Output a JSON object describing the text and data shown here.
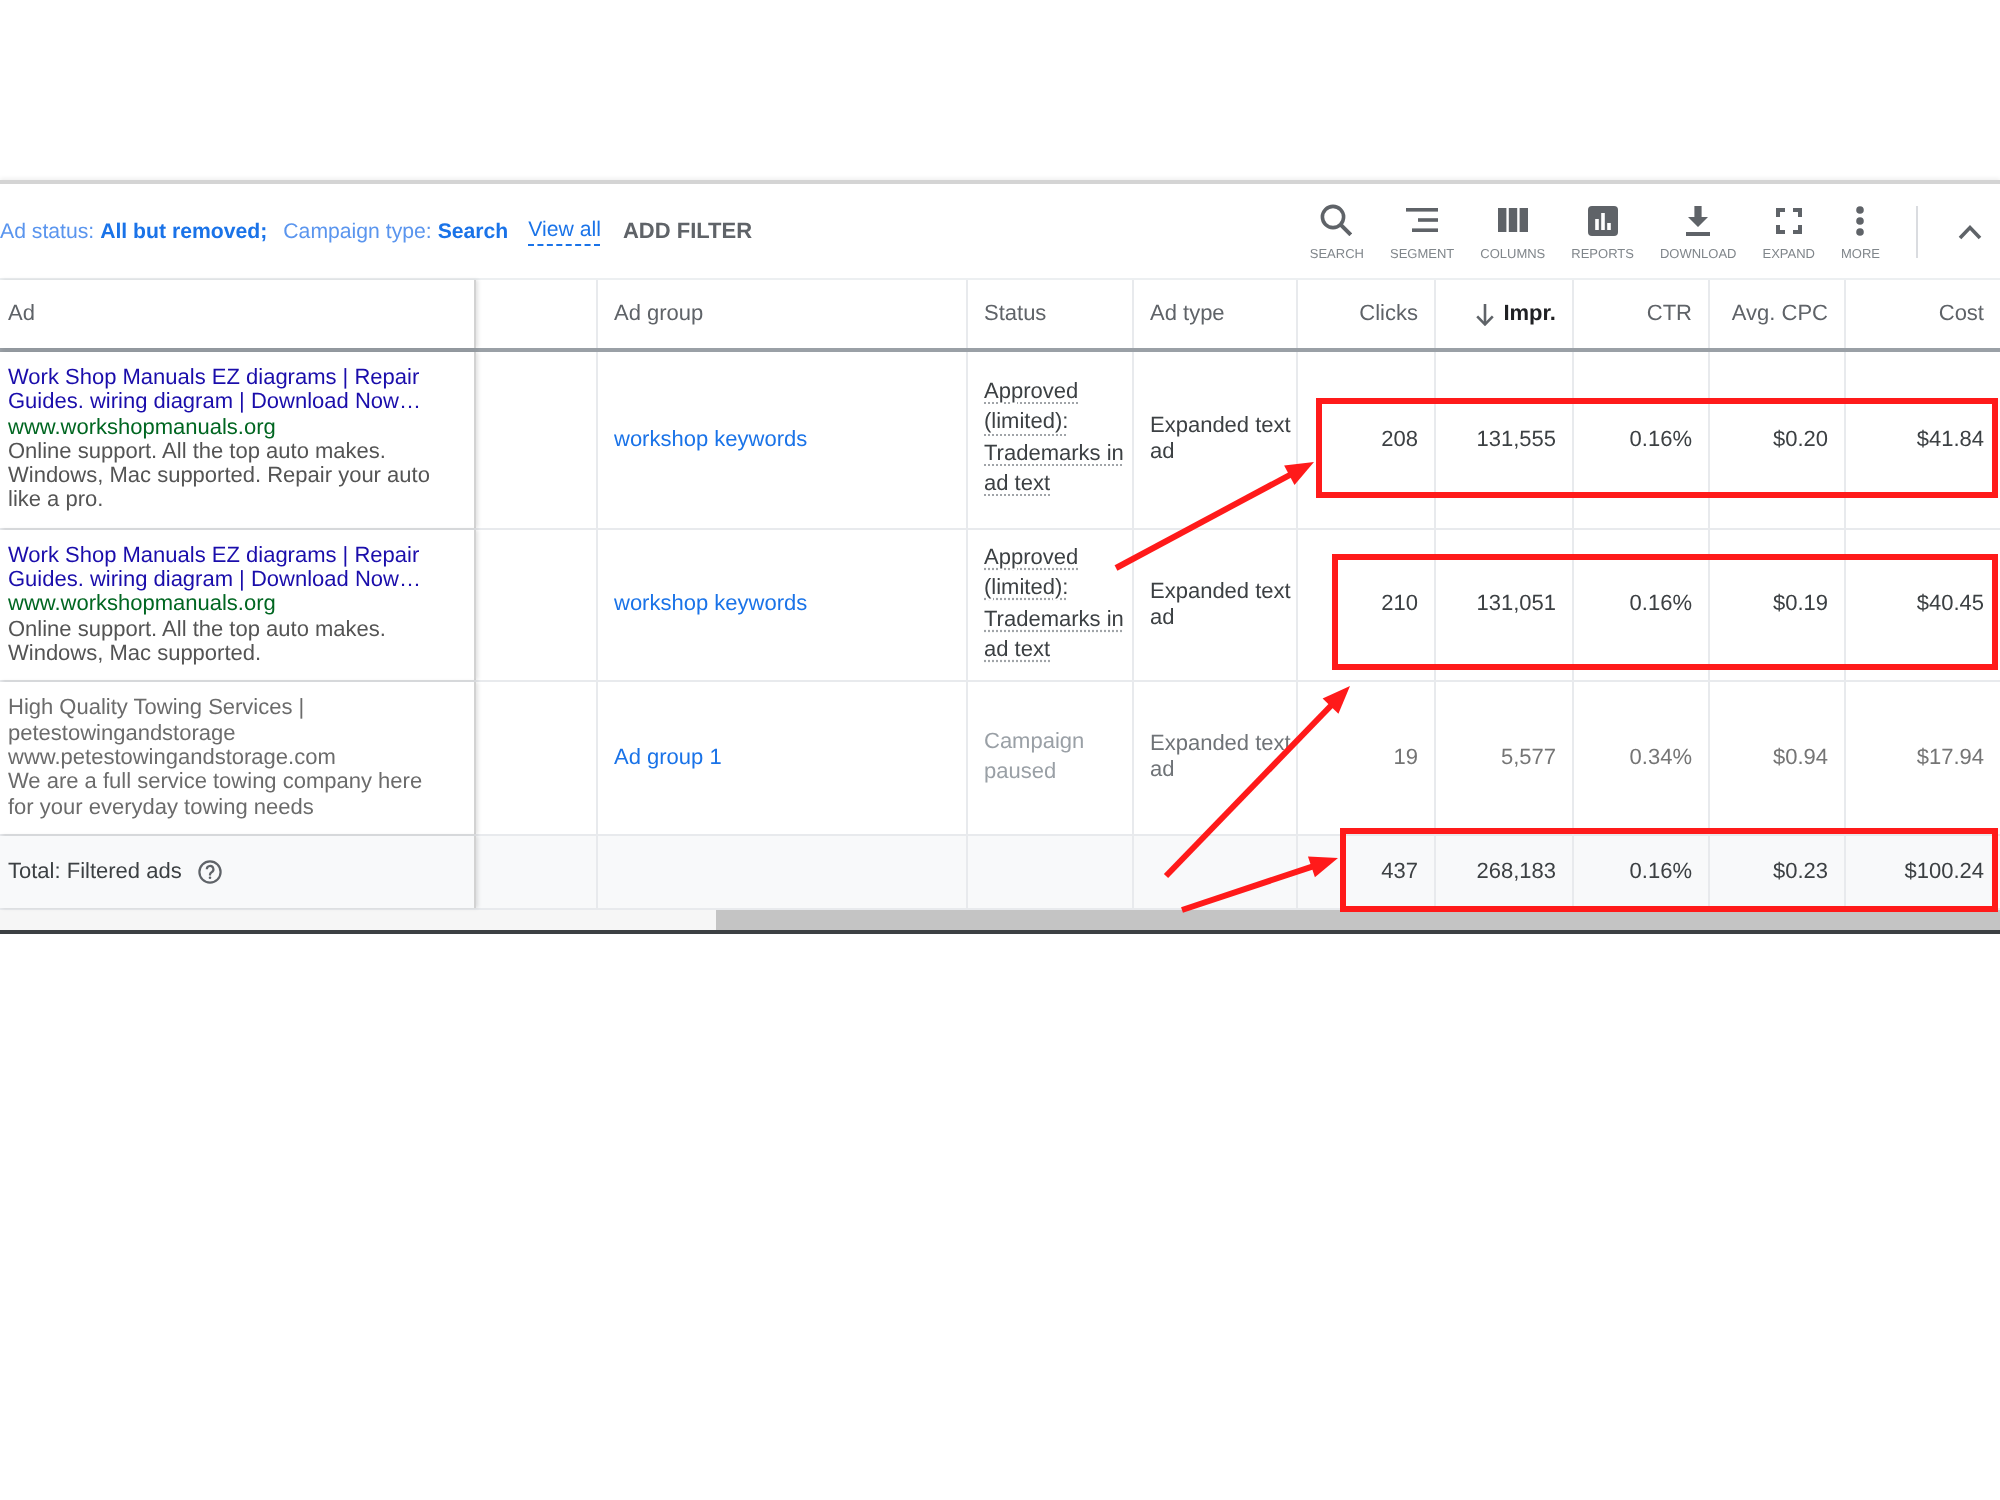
{
  "filter_bar": {
    "filters": [
      "Ad status: **All but removed;**",
      "Campaign type: **Search**"
    ],
    "view_all": "View all",
    "add_filter": "ADD FILTER"
  },
  "toolbar": {
    "tools": [
      {
        "kind": "search",
        "label": "SEARCH"
      },
      {
        "kind": "segment",
        "label": "SEGMENT"
      },
      {
        "kind": "columns",
        "label": "COLUMNS"
      },
      {
        "kind": "reports",
        "label": "REPORTS"
      },
      {
        "kind": "download",
        "label": "DOWNLOAD"
      },
      {
        "kind": "expand",
        "label": "EXPAND"
      },
      {
        "kind": "more",
        "label": "MORE"
      }
    ]
  },
  "table": {
    "columns": [
      {
        "label": "Ad",
        "kind": "ad",
        "sorted": false
      },
      {
        "label": "Ad group",
        "kind": "ad_group",
        "sorted": false
      },
      {
        "label": "Status",
        "kind": "status",
        "sorted": false
      },
      {
        "label": "Ad type",
        "kind": "ad_type",
        "sorted": false
      },
      {
        "label": "Clicks",
        "kind": "metric",
        "sorted": false
      },
      {
        "label": "Impr.",
        "kind": "metric",
        "sorted": true
      },
      {
        "label": "CTR",
        "kind": "metric",
        "sorted": false
      },
      {
        "label": "Avg. CPC",
        "kind": "metric",
        "sorted": false
      },
      {
        "label": "Cost",
        "kind": "metric",
        "sorted": false
      }
    ],
    "rows": [
      {
        "headline": "Work Shop Manuals EZ diagrams | Repair Guides. wiring diagram | Download Now…",
        "url": "www.workshopmanuals.org",
        "description": "Online support. All the top auto makes. Windows, Mac supported. Repair your auto like a pro.",
        "ad_group": "workshop keywords",
        "status": "Approved (limited): Trademarks in ad text",
        "ad_type": "Expanded text ad",
        "metrics": [
          "208",
          "131,555",
          "0.16%",
          "$0.20",
          "$41.84"
        ],
        "paused": false,
        "highlighted": true
      },
      {
        "headline": "Work Shop Manuals EZ diagrams | Repair Guides. wiring diagram | Download Now…",
        "url": "www.workshopmanuals.org",
        "description": "Online support. All the top auto makes. Windows, Mac supported.",
        "ad_group": "workshop keywords",
        "status": "Approved (limited): Trademarks in ad text",
        "ad_type": "Expanded text ad",
        "metrics": [
          "210",
          "131,051",
          "0.16%",
          "$0.19",
          "$40.45"
        ],
        "paused": false,
        "highlighted": true
      },
      {
        "headline": "High Quality Towing Services | petestowingandstorage",
        "url": "www.petestowingandstorage.com",
        "description": "We are a full service towing company here for your everyday towing needs",
        "ad_group": "Ad group 1",
        "status": "Campaign paused",
        "ad_type": "Expanded text ad",
        "metrics": [
          "19",
          "5,577",
          "0.34%",
          "$0.94",
          "$17.94"
        ],
        "paused": true,
        "highlighted": false
      }
    ],
    "total": {
      "label": "Total: Filtered ads",
      "metrics": [
        "437",
        "268,183",
        "0.16%",
        "$0.23",
        "$100.24"
      ],
      "highlighted": true
    }
  }
}
